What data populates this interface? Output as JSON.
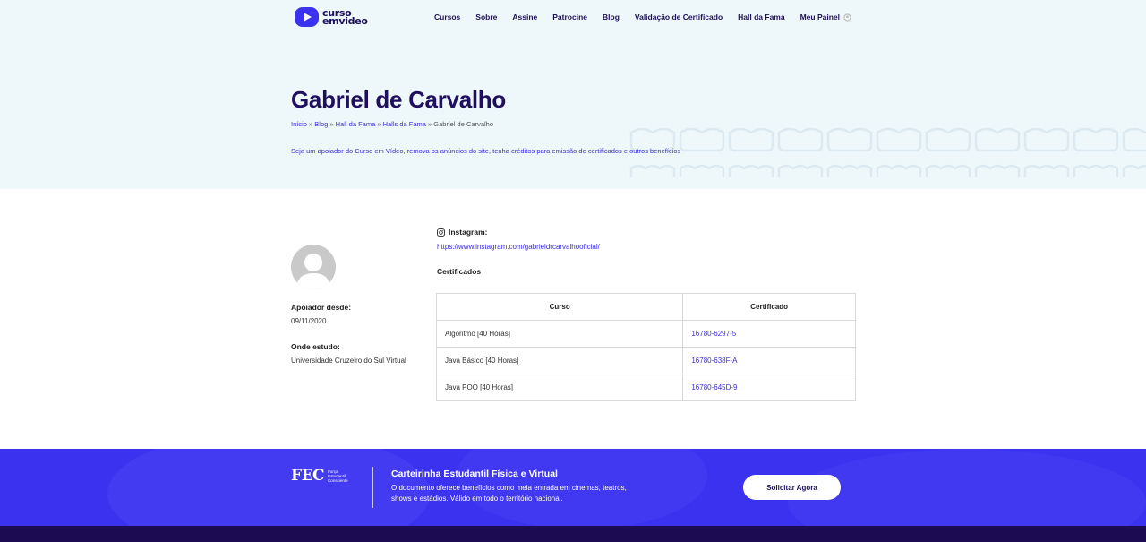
{
  "brand": {
    "logo_line1": "curso",
    "logo_line2": "emvideo",
    "accent_color": "#3b32f0",
    "dark_color": "#1f0f5e"
  },
  "nav": {
    "items": [
      {
        "label": "Cursos"
      },
      {
        "label": "Sobre"
      },
      {
        "label": "Assine"
      },
      {
        "label": "Patrocine"
      },
      {
        "label": "Blog"
      },
      {
        "label": "Validação de Certificado"
      },
      {
        "label": "Hall da Fama"
      }
    ],
    "panel_label": "Meu Painel",
    "panel_icon": "user-icon"
  },
  "hero": {
    "title": "Gabriel de Carvalho",
    "breadcrumb": [
      {
        "label": "Início"
      },
      {
        "label": "Blog"
      },
      {
        "label": "Hall da Fama"
      },
      {
        "label": "Halls da Fama"
      },
      {
        "label": "Gabriel de Carvalho"
      }
    ],
    "breadcrumb_separator": " » ",
    "promo_text": "Seja um apoiador do Curso em Vídeo, remova os anúncios do site, tenha créditos para emissão de certificados e outros benefícios"
  },
  "profile": {
    "avatar_icon": "default-avatar-icon",
    "supporter_since_label": "Apoiador desde:",
    "supporter_since_value": "09/11/2020",
    "school_label": "Onde estudo:",
    "school_value": "Universidade Cruzeiro do Sul Virtual"
  },
  "social": {
    "instagram_label": "Instagram:",
    "instagram_icon": "instagram-icon",
    "instagram_url": "https://www.instagram.com/gabrieldrcarvalhooficial/"
  },
  "certificates": {
    "heading": "Certificados",
    "columns": [
      "Curso",
      "Certificado"
    ],
    "rows": [
      {
        "course": "Algoritmo [40 Horas]",
        "code": "16780-6297-5"
      },
      {
        "course": "Java Básico [40 Horas]",
        "code": "16780-638F-A"
      },
      {
        "course": "Java POO [40 Horas]",
        "code": "16780-645D-9"
      }
    ]
  },
  "banner": {
    "logo": "FEC",
    "logo_caption": "Força Estudantil Consciente",
    "title": "Carteirinha Estudantil Física e Virtual",
    "text": "O documento oferece benefícios como meia entrada em cinemas, teatros, shows e estádios. Válido em todo o território nacional.",
    "button_label": "Solicitar Agora"
  }
}
